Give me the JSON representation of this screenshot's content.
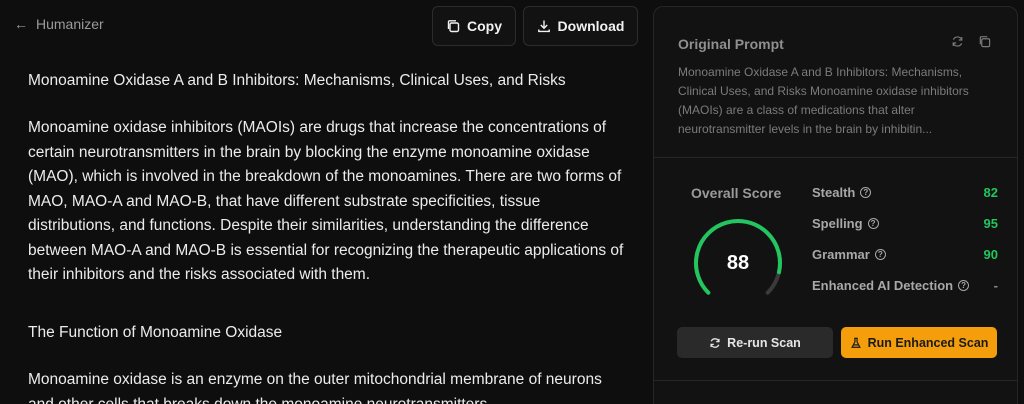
{
  "header": {
    "back_label": "Humanizer",
    "copy_label": "Copy",
    "download_label": "Download"
  },
  "article": {
    "title": "Monoamine Oxidase A and B Inhibitors: Mechanisms, Clinical Uses, and Risks",
    "intro": "Monoamine oxidase inhibitors (MAOIs) are drugs that increase the concentrations of certain neurotransmitters in the brain by blocking the enzyme monoamine oxidase (MAO), which is involved in the breakdown of the monoamines. There are two forms of MAO, MAO-A and MAO-B, that have different substrate specificities, tissue distributions, and functions. Despite their similarities, understanding the difference between MAO-A and MAO-B is essential for recognizing the therapeutic applications of their inhibitors and the risks associated with them.",
    "section_title": "The Function of Monoamine Oxidase",
    "section_text": "Monoamine oxidase is an enzyme on the outer mitochondrial membrane of neurons and other cells that breaks down the monoamine neurotransmitters"
  },
  "panel": {
    "original_prompt_title": "Original Prompt",
    "original_prompt_text": "Monoamine Oxidase A and B Inhibitors: Mechanisms, Clinical Uses, and Risks Monoamine oxidase inhibitors (MAOIs) are a class of medications that alter neurotransmitter levels in the brain by inhibitin...",
    "overall_score_label": "Overall Score",
    "overall_score": 88,
    "metrics": [
      {
        "name": "Stealth",
        "value": "82"
      },
      {
        "name": "Spelling",
        "value": "95"
      },
      {
        "name": "Grammar",
        "value": "90"
      },
      {
        "name": "Enhanced AI Detection",
        "value": "-"
      }
    ],
    "rerun_label": "Re-run Scan",
    "enhanced_label": "Run Enhanced Scan"
  },
  "colors": {
    "accent_green": "#22c55e",
    "accent_orange": "#f59e0b",
    "background": "#0e0e0e"
  },
  "icons": {
    "back": "arrow-left-icon",
    "copy": "copy-icon",
    "download": "download-icon",
    "refresh": "refresh-icon",
    "duplicate": "copy-icon",
    "help": "question-circle-icon",
    "rerun": "refresh-icon",
    "enhanced": "flask-icon"
  }
}
